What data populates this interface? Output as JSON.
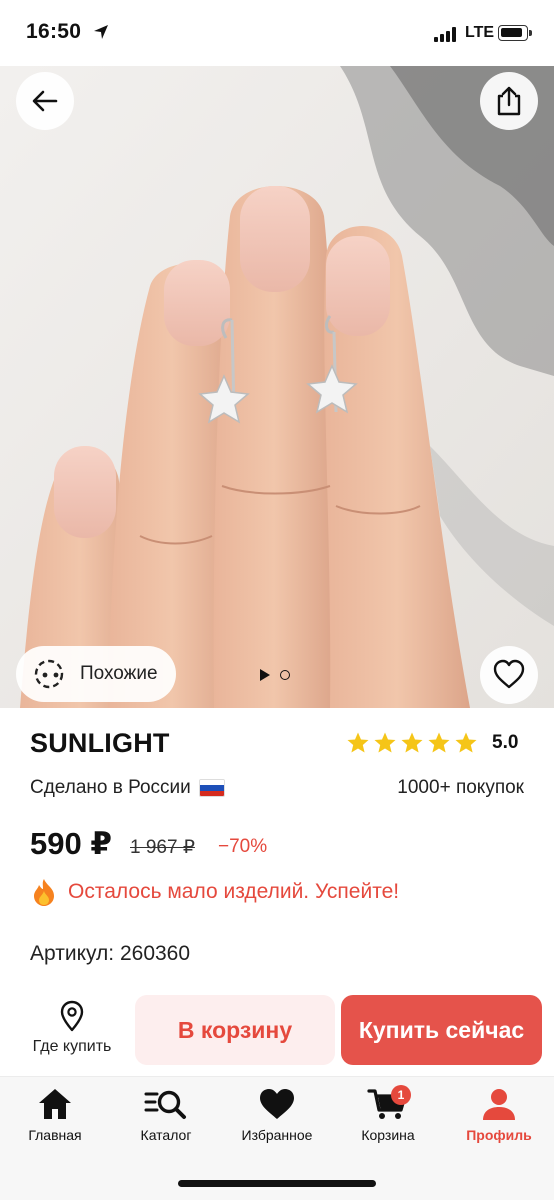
{
  "status_bar": {
    "time": "16:50",
    "network": "LTE"
  },
  "product": {
    "brand": "SUNLIGHT",
    "rating": "5.0",
    "stars": 5,
    "origin": "Сделано в России",
    "purchases": "1000+ покупок",
    "price": "590 ₽",
    "old_price": "1 967 ₽",
    "discount": "−70%",
    "low_stock": "Осталось мало изделий. Успейте!",
    "article": "Артикул: 260360"
  },
  "gallery": {
    "similar_label": "Похожие",
    "slides_total": 2,
    "slide_current": 1
  },
  "actions": {
    "where_buy": "Где купить",
    "add_to_cart": "В корзину",
    "buy_now": "Купить сейчас"
  },
  "nav": {
    "items": [
      {
        "label": "Главная",
        "icon": "home-icon"
      },
      {
        "label": "Каталог",
        "icon": "catalog-search-icon"
      },
      {
        "label": "Избранное",
        "icon": "heart-icon"
      },
      {
        "label": "Корзина",
        "icon": "cart-icon",
        "badge": "1"
      },
      {
        "label": "Профиль",
        "icon": "profile-icon",
        "active": true
      }
    ]
  },
  "colors": {
    "accent": "#e5493d",
    "buy_button": "#e5534b",
    "cart_button_bg": "#fdeeee",
    "star": "#f5c518"
  }
}
